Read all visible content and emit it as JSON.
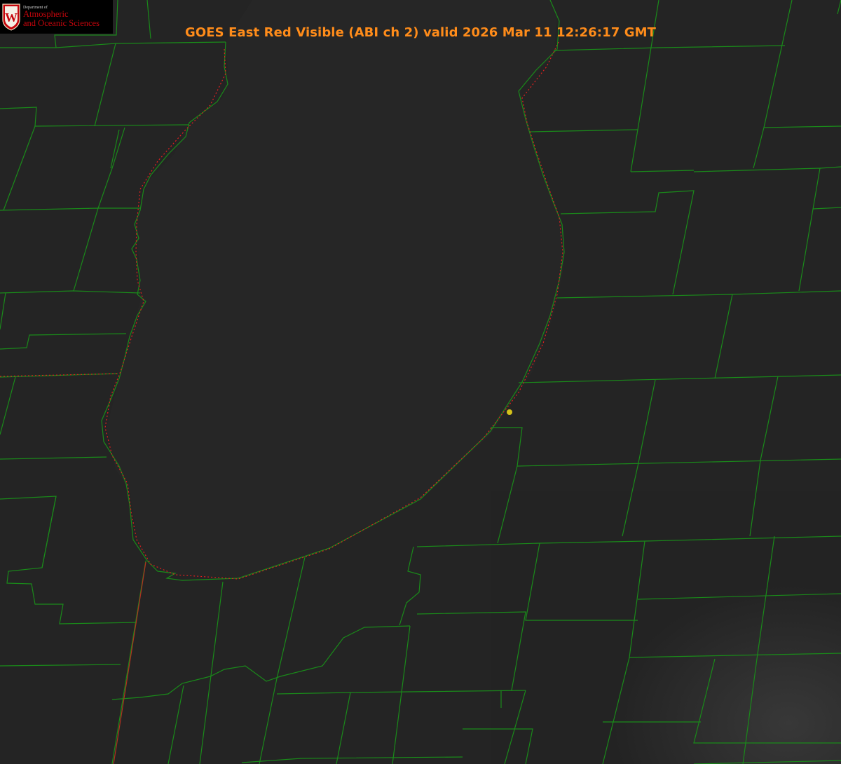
{
  "header": {
    "title": "GOES East Red Visible (ABI ch 2) valid 2026 Mar 11 12:26:17 GMT",
    "title_color": "#ff8c1a"
  },
  "logo": {
    "department_line": "Department of",
    "name_line1": "Atmospheric",
    "name_line2": "and Oceanic Sciences",
    "shield_letter": "W",
    "shield_color": "#c5050c"
  },
  "map": {
    "imagery": "visible satellite, grayscale",
    "boundary_color": "#1a8a1a",
    "coastline_color": "#e02020",
    "marker_color": "#d4c21a",
    "lake_shade": "#262626"
  }
}
